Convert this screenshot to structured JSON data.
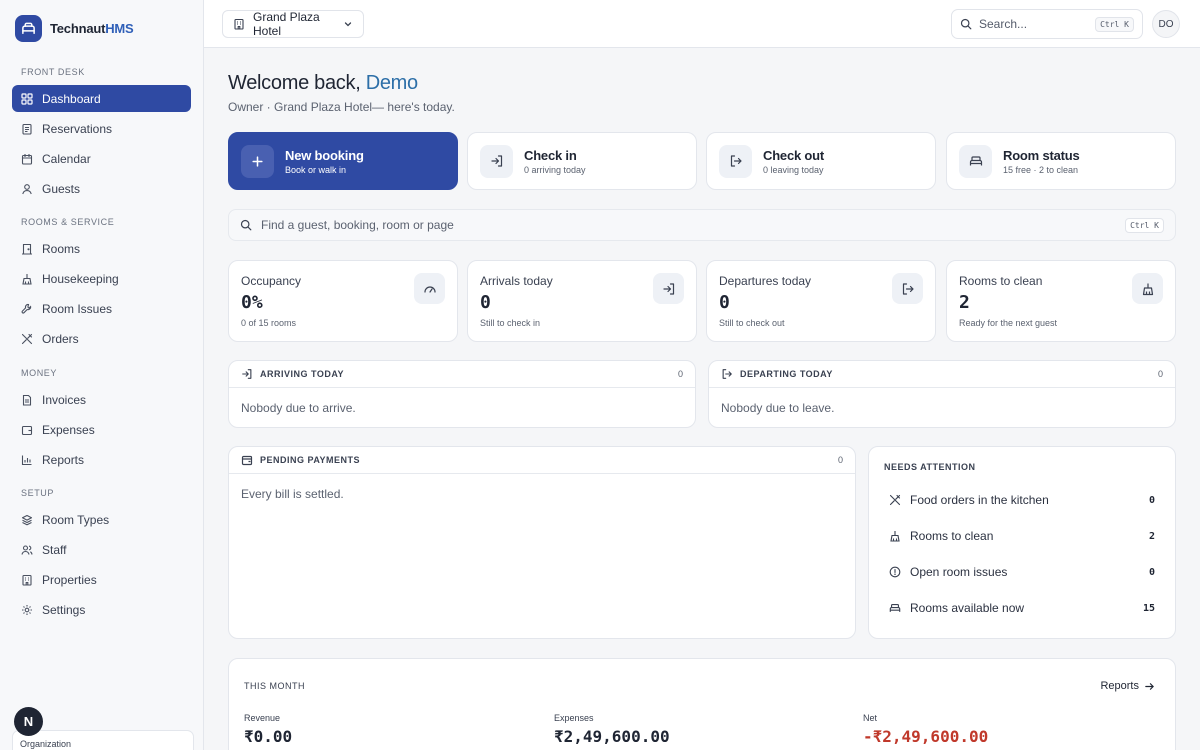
{
  "brand": {
    "name": "Technaut",
    "name_accent": "HMS"
  },
  "sidebar": {
    "sections": [
      {
        "label": "FRONT DESK"
      },
      {
        "label": "ROOMS & SERVICE"
      },
      {
        "label": "MONEY"
      },
      {
        "label": "SETUP"
      }
    ],
    "items": [
      {
        "label": "Dashboard",
        "icon": "grid-icon",
        "active": true
      },
      {
        "label": "Reservations",
        "icon": "clipboard-icon"
      },
      {
        "label": "Calendar",
        "icon": "calendar-icon"
      },
      {
        "label": "Guests",
        "icon": "user-icon"
      },
      {
        "label": "Rooms",
        "icon": "door-icon"
      },
      {
        "label": "Housekeeping",
        "icon": "broom-icon"
      },
      {
        "label": "Room Issues",
        "icon": "wrench-icon"
      },
      {
        "label": "Orders",
        "icon": "utensils-icon"
      },
      {
        "label": "Invoices",
        "icon": "file-icon"
      },
      {
        "label": "Expenses",
        "icon": "wallet-icon"
      },
      {
        "label": "Reports",
        "icon": "bar-chart-icon"
      },
      {
        "label": "Room Types",
        "icon": "layers-icon"
      },
      {
        "label": "Staff",
        "icon": "users-icon"
      },
      {
        "label": "Properties",
        "icon": "building-icon"
      },
      {
        "label": "Settings",
        "icon": "gear-icon"
      }
    ],
    "org_avatar": "N",
    "org_label": "Organization"
  },
  "topbar": {
    "hotel": "Grand Plaza Hotel",
    "search_placeholder": "Search...",
    "search_shortcut": "Ctrl K",
    "user_initials": "DO"
  },
  "welcome": {
    "greeting": "Welcome back,",
    "name": "Demo",
    "subtitle": "Owner · Grand Plaza Hotel— here's today."
  },
  "actions": [
    {
      "title": "New booking",
      "subtitle": "Book or walk in",
      "icon": "plus-icon"
    },
    {
      "title": "Check in",
      "subtitle": "0 arriving today",
      "icon": "login-icon"
    },
    {
      "title": "Check out",
      "subtitle": "0 leaving today",
      "icon": "logout-icon"
    },
    {
      "title": "Room status",
      "subtitle": "15 free · 2 to clean",
      "icon": "bed-icon"
    }
  ],
  "find": {
    "placeholder": "Find a guest, booking, room or page",
    "shortcut": "Ctrl K"
  },
  "stats": [
    {
      "label": "Occupancy",
      "value": "0%",
      "hint": "0 of 15 rooms",
      "icon": "gauge-icon"
    },
    {
      "label": "Arrivals today",
      "value": "0",
      "hint": "Still to check in",
      "icon": "login-icon"
    },
    {
      "label": "Departures today",
      "value": "0",
      "hint": "Still to check out",
      "icon": "logout-icon"
    },
    {
      "label": "Rooms to clean",
      "value": "2",
      "hint": "Ready for the next guest",
      "icon": "broom-icon"
    }
  ],
  "arriving": {
    "title": "ARRIVING TODAY",
    "count": "0",
    "empty": "Nobody due to arrive."
  },
  "departing": {
    "title": "DEPARTING TODAY",
    "count": "0",
    "empty": "Nobody due to leave."
  },
  "payments": {
    "title": "PENDING PAYMENTS",
    "count": "0",
    "empty": "Every bill is settled."
  },
  "attention": {
    "title": "NEEDS ATTENTION",
    "rows": [
      {
        "label": "Food orders in the kitchen",
        "value": "0",
        "icon": "utensils-icon"
      },
      {
        "label": "Rooms to clean",
        "value": "2",
        "icon": "broom-icon"
      },
      {
        "label": "Open room issues",
        "value": "0",
        "icon": "alert-circle-icon"
      },
      {
        "label": "Rooms available now",
        "value": "15",
        "icon": "bed-icon"
      }
    ]
  },
  "month": {
    "title": "THIS MONTH",
    "link": "Reports",
    "revenue_label": "Revenue",
    "revenue": "₹0.00",
    "expenses_label": "Expenses",
    "expenses": "₹2,49,600.00",
    "net_label": "Net",
    "net": "-₹2,49,600.00"
  },
  "colors": {
    "primary": "#2f4aa3",
    "accent_name": "#2d6fa8",
    "negative": "#c0392b"
  }
}
